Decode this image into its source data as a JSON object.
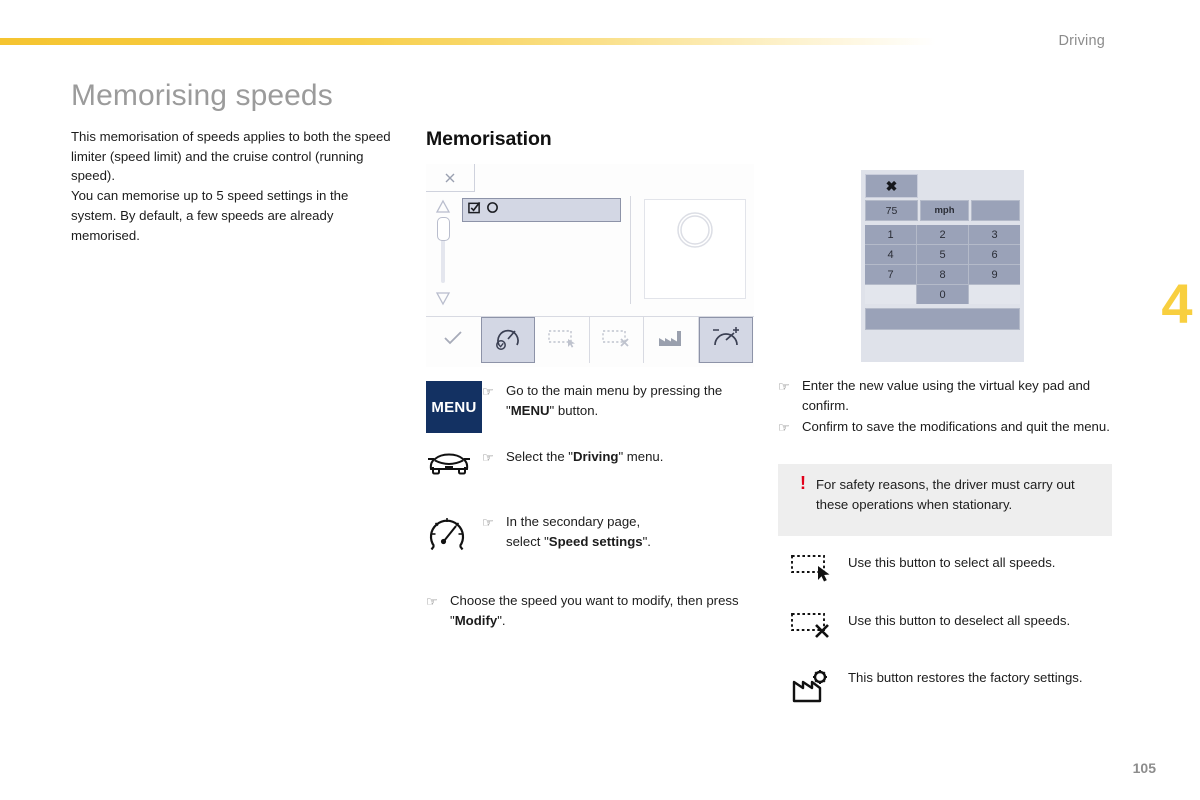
{
  "header": {
    "section": "Driving",
    "chapter_number": "4",
    "accent_color": "#f5c430"
  },
  "page": {
    "title": "Memorising speeds",
    "number": "105"
  },
  "intro": {
    "paragraph_1": "This memorisation of speeds applies to both the speed limiter (speed limit) and the cruise control (running speed).",
    "paragraph_2": "You can memorise up to 5 speed settings in the system. By default, a few speeds are already memorised."
  },
  "section": {
    "title": "Memorisation"
  },
  "hmi": {
    "tab_icon": "close-icon",
    "scrollbar": {
      "up_icon": "triangle-up-icon",
      "down_icon": "triangle-down-icon"
    },
    "list_row_icons": [
      "edit-checkbox-icon",
      "circle-icon"
    ],
    "preview_icon": "circle-gauge-icon",
    "toolbar_buttons": [
      {
        "name": "confirm-check-icon",
        "active": false
      },
      {
        "name": "speed-settings-icon",
        "active": true
      },
      {
        "name": "select-all-speeds-icon",
        "active": false
      },
      {
        "name": "deselect-all-speeds-icon",
        "active": false
      },
      {
        "name": "factory-settings-icon",
        "active": false
      },
      {
        "name": "adjust-speed-icon",
        "active": true
      }
    ]
  },
  "keypad": {
    "close_label": "✖",
    "value": "75",
    "unit": "mph",
    "keys": [
      "1",
      "2",
      "3",
      "4",
      "5",
      "6",
      "7",
      "8",
      "9",
      "",
      "0",
      ""
    ]
  },
  "steps_middle": [
    {
      "icon": "menu-button",
      "icon_label": "MENU",
      "pointer": "☞",
      "text_parts": [
        {
          "t": "Go to the main menu by pressing the \"",
          "bold": false
        },
        {
          "t": "MENU",
          "bold": true
        },
        {
          "t": "\" button.",
          "bold": false
        }
      ]
    },
    {
      "icon": "car-front-icon",
      "pointer": "☞",
      "text_parts": [
        {
          "t": "Select the \"",
          "bold": false
        },
        {
          "t": "Driving",
          "bold": true
        },
        {
          "t": "\" menu.",
          "bold": false
        }
      ]
    },
    {
      "icon": "speedometer-icon",
      "pointer": "☞",
      "text_parts": [
        {
          "t": "In the secondary page, select \"",
          "bold": false
        },
        {
          "t": "Speed settings",
          "bold": true
        },
        {
          "t": "\".",
          "bold": false
        }
      ]
    },
    {
      "icon": "none",
      "pointer": "☞",
      "text_parts": [
        {
          "t": "Choose the speed you want to modify, then press \"",
          "bold": false
        },
        {
          "t": "Modify",
          "bold": true
        },
        {
          "t": "\".",
          "bold": false
        }
      ]
    }
  ],
  "steps_right": [
    {
      "pointer": "☞",
      "text_parts": [
        {
          "t": "Enter the new value using the virtual key pad and confirm.",
          "bold": false
        }
      ]
    },
    {
      "pointer": "☞",
      "text_parts": [
        {
          "t": "Confirm to save the modifications and quit the menu.",
          "bold": false
        }
      ]
    }
  ],
  "warning": {
    "mark": "!",
    "mark_color": "#e2001a",
    "text": "For safety reasons, the driver must carry out these operations when stationary."
  },
  "legend": [
    {
      "icon": "select-all-speeds-icon",
      "text": "Use this button to select all speeds."
    },
    {
      "icon": "deselect-all-speeds-icon",
      "text": "Use this button to deselect all speeds."
    },
    {
      "icon": "factory-settings-icon",
      "text": "This button restores the factory settings."
    }
  ]
}
